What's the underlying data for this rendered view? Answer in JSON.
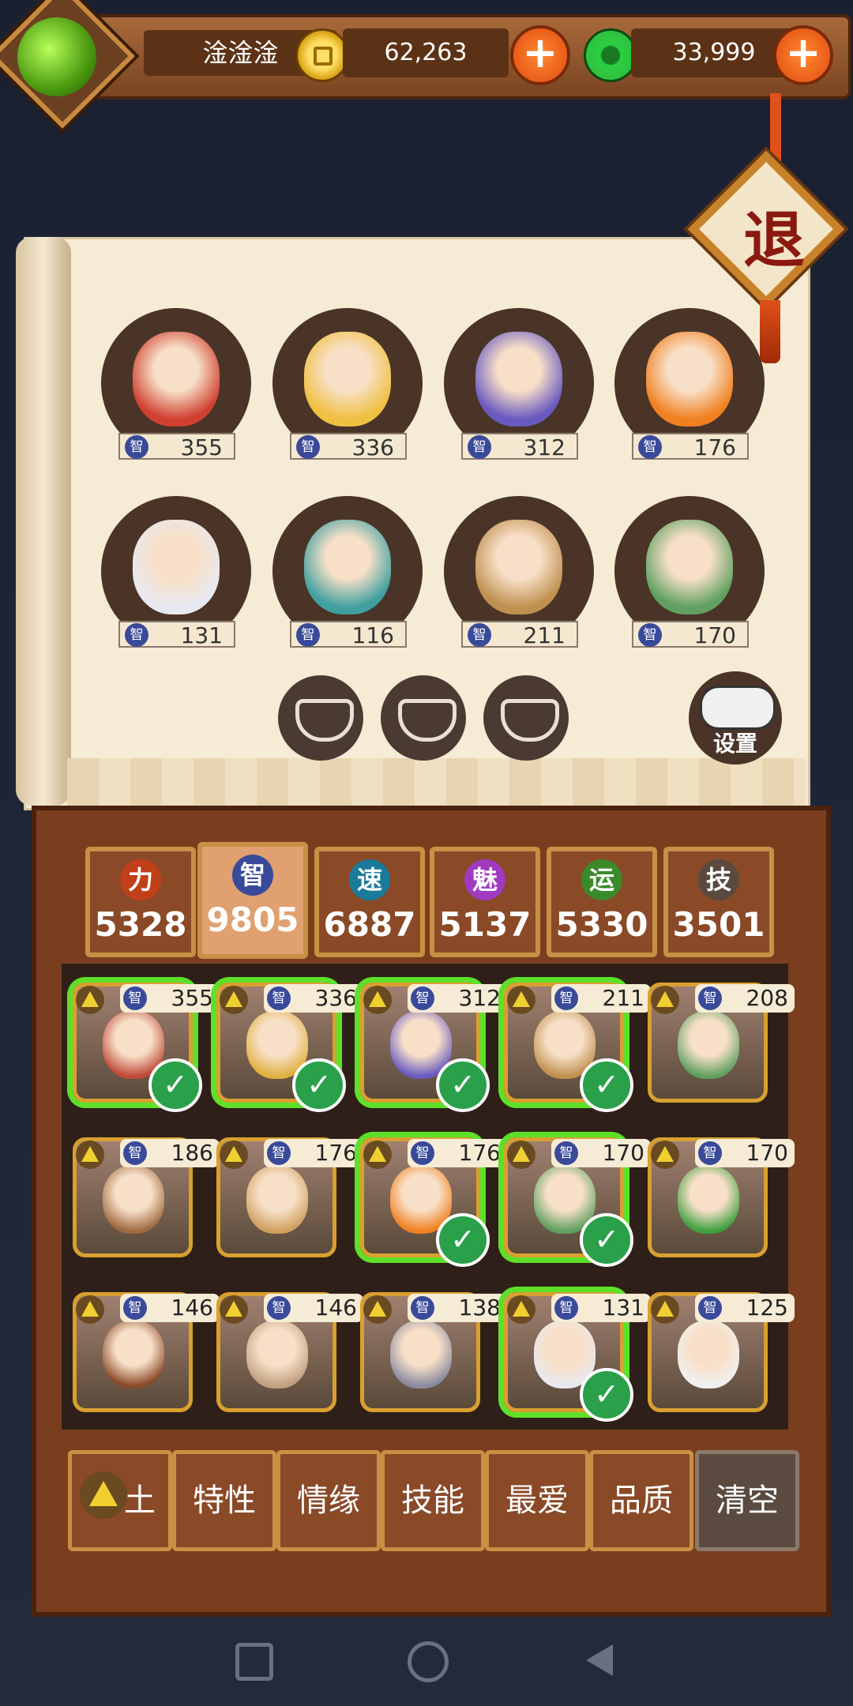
{
  "player": {
    "name": "淦淦淦"
  },
  "currency": {
    "gold": "62,263",
    "jade": "33,999",
    "add_symbol": "+"
  },
  "exit_label": "退",
  "lineup": [
    {
      "stat_badge": "智",
      "value": "355"
    },
    {
      "stat_badge": "智",
      "value": "336"
    },
    {
      "stat_badge": "智",
      "value": "312"
    },
    {
      "stat_badge": "智",
      "value": "176"
    },
    {
      "stat_badge": "智",
      "value": "131"
    },
    {
      "stat_badge": "智",
      "value": "116"
    },
    {
      "stat_badge": "智",
      "value": "211"
    },
    {
      "stat_badge": "智",
      "value": "170"
    }
  ],
  "settings_label": "设置",
  "stat_tabs": [
    {
      "icon": "力",
      "value": "5328",
      "color": "#c0401a"
    },
    {
      "icon": "智",
      "value": "9805",
      "color": "#3a4a9a"
    },
    {
      "icon": "速",
      "value": "6887",
      "color": "#1a7a9a"
    },
    {
      "icon": "魅",
      "value": "5137",
      "color": "#a03ac0"
    },
    {
      "icon": "运",
      "value": "5330",
      "color": "#3a8a2a"
    },
    {
      "icon": "技",
      "value": "3501",
      "color": "#5a4a40"
    }
  ],
  "roster": [
    {
      "badge": "智",
      "value": "355",
      "selected": true
    },
    {
      "badge": "智",
      "value": "336",
      "selected": true
    },
    {
      "badge": "智",
      "value": "312",
      "selected": true
    },
    {
      "badge": "智",
      "value": "211",
      "selected": true
    },
    {
      "badge": "智",
      "value": "208",
      "selected": false
    },
    {
      "badge": "智",
      "value": "186",
      "selected": false
    },
    {
      "badge": "智",
      "value": "176",
      "selected": false
    },
    {
      "badge": "智",
      "value": "176",
      "selected": true
    },
    {
      "badge": "智",
      "value": "170",
      "selected": true
    },
    {
      "badge": "智",
      "value": "170",
      "selected": false
    },
    {
      "badge": "智",
      "value": "146",
      "selected": false
    },
    {
      "badge": "智",
      "value": "146",
      "selected": false
    },
    {
      "badge": "智",
      "value": "138",
      "selected": false
    },
    {
      "badge": "智",
      "value": "131",
      "selected": true
    },
    {
      "badge": "智",
      "value": "125",
      "selected": false
    }
  ],
  "filters": [
    "土",
    "特性",
    "情缘",
    "技能",
    "最爱",
    "品质",
    "清空"
  ],
  "check_mark": "✓"
}
